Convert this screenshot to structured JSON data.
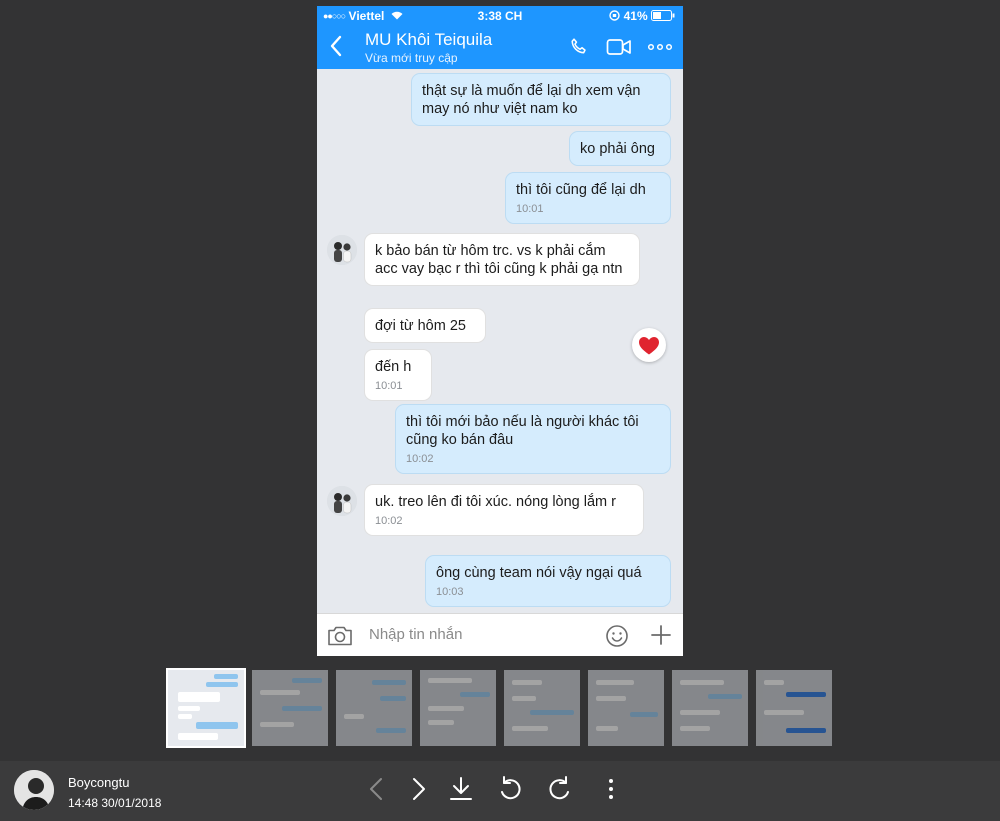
{
  "status_bar": {
    "carrier": "Viettel",
    "time": "3:38 CH",
    "battery": "41%"
  },
  "chat_header": {
    "contact_name": "MU Khôi Teiquila",
    "contact_status": "Vừa mới truy cập"
  },
  "messages": [
    {
      "dir": "out",
      "text": "thật sự là muốn để lại dh xem vận may nó như việt nam ko",
      "time": ""
    },
    {
      "dir": "out",
      "text": "ko phải ông",
      "time": ""
    },
    {
      "dir": "out",
      "text": "thì tôi cũng để lại dh",
      "time": "10:01"
    },
    {
      "dir": "in",
      "text": "k bảo bán từ hôm trc. vs k phải cắm acc vay bạc r thì tôi cũng k phải gạ ntn",
      "time": ""
    },
    {
      "dir": "in",
      "text": "đợi từ hôm 25",
      "time": ""
    },
    {
      "dir": "in",
      "text": "đến h",
      "time": "10:01"
    },
    {
      "dir": "out",
      "text": "thì tôi mới bảo nếu là người khác tôi cũng ko bán đâu",
      "time": "10:02"
    },
    {
      "dir": "in",
      "text": "uk. treo lên đi tôi xúc. nóng lòng lắm r",
      "time": "10:02"
    },
    {
      "dir": "out",
      "text": "ông cùng team nói vậy ngại quá",
      "time": "10:03"
    }
  ],
  "reaction": {
    "emoji": "❤️"
  },
  "composer": {
    "placeholder": "Nhập tin nhắn"
  },
  "thumbnails": {
    "count": 8,
    "active_index": 0
  },
  "viewer_footer": {
    "uploader_name": "Boycongtu",
    "upload_time": "14:48 30/01/2018"
  },
  "colors": {
    "zalo_blue": "#1e96ff",
    "outgoing_bubble": "#d5ecfd",
    "chat_bg": "#e6e9ee",
    "viewer_bg": "#333334"
  },
  "icons": [
    "back-arrow-icon",
    "phone-icon",
    "video-call-icon",
    "more-icon",
    "camera-icon",
    "emoji-icon",
    "plus-icon",
    "prev-icon",
    "next-icon",
    "download-icon",
    "rotate-left-icon",
    "rotate-right-icon",
    "more-vertical-icon",
    "heart-icon"
  ]
}
